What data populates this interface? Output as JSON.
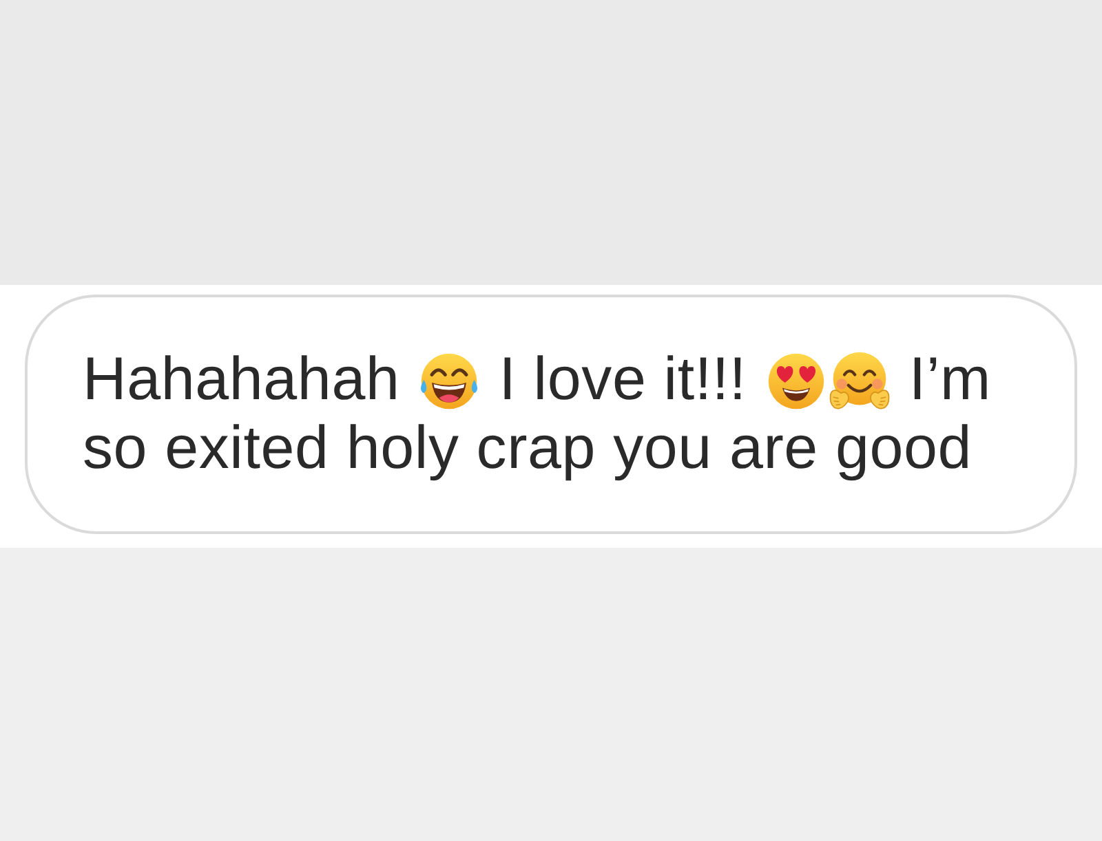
{
  "message": {
    "lines": [
      {
        "parts": [
          {
            "kind": "text",
            "text": "Hahahahah"
          },
          {
            "kind": "laughing"
          },
          {
            "kind": "text",
            "text": "I love it!!!"
          },
          {
            "kind": "hearteyes"
          },
          {
            "kind": "hugging"
          },
          {
            "kind": "text",
            "text": "I’m"
          }
        ]
      },
      {
        "parts": [
          {
            "kind": "text",
            "text": "so exited holy crap you are good"
          }
        ]
      }
    ]
  }
}
